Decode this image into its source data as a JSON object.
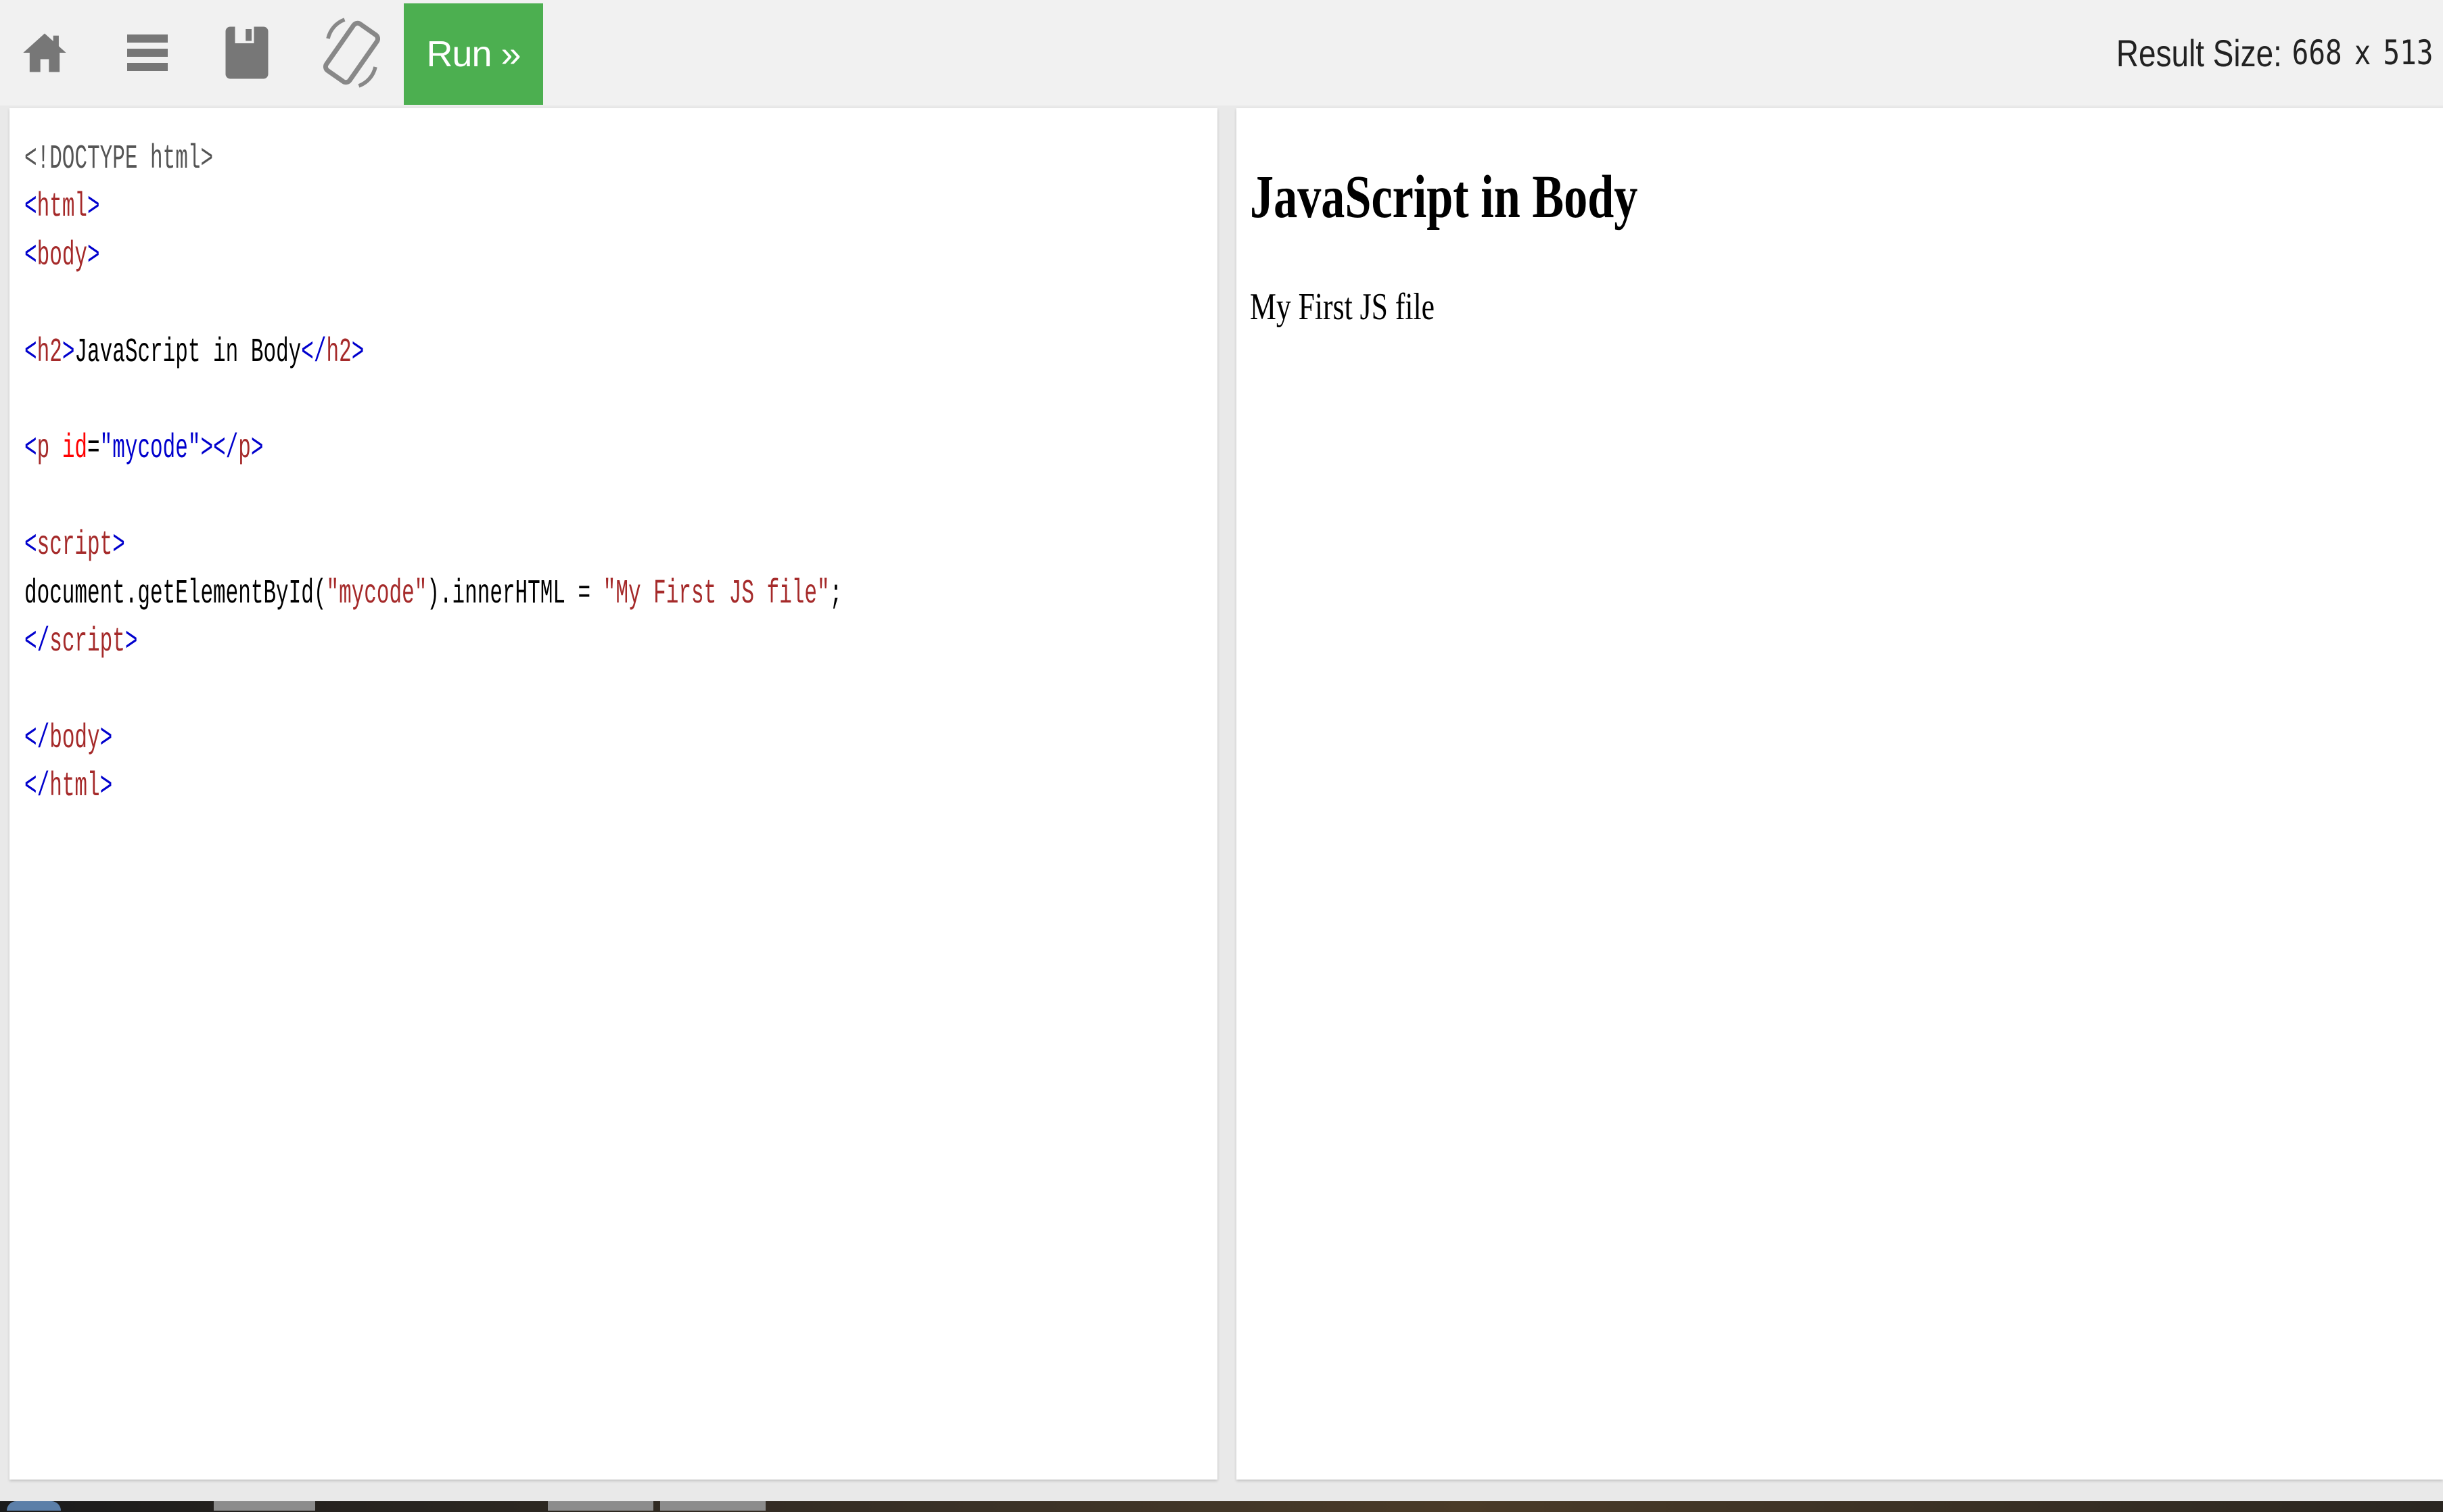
{
  "toolbar": {
    "icons": [
      "home-icon",
      "menu-icon",
      "save-icon",
      "rotate-icon"
    ],
    "run_label": "Run »",
    "result_size_label": "Result Size:",
    "result_width": "668",
    "result_x": "x",
    "result_height": "513"
  },
  "editor": {
    "lines": [
      [
        {
          "t": "doc",
          "s": "<!DOCTYPE html>"
        }
      ],
      [
        {
          "t": "br",
          "s": "<"
        },
        {
          "t": "tag",
          "s": "html"
        },
        {
          "t": "br",
          "s": ">"
        }
      ],
      [
        {
          "t": "br",
          "s": "<"
        },
        {
          "t": "tag",
          "s": "body"
        },
        {
          "t": "br",
          "s": ">"
        }
      ],
      [],
      [
        {
          "t": "br",
          "s": "<"
        },
        {
          "t": "tag",
          "s": "h2"
        },
        {
          "t": "br",
          "s": ">"
        },
        {
          "t": "txt",
          "s": "JavaScript in Body"
        },
        {
          "t": "br",
          "s": "</"
        },
        {
          "t": "tag",
          "s": "h2"
        },
        {
          "t": "br",
          "s": ">"
        }
      ],
      [],
      [
        {
          "t": "br",
          "s": "<"
        },
        {
          "t": "tag",
          "s": "p "
        },
        {
          "t": "attr",
          "s": "id"
        },
        {
          "t": "txt",
          "s": "="
        },
        {
          "t": "val",
          "s": "\"mycode\""
        },
        {
          "t": "br",
          "s": "></"
        },
        {
          "t": "tag",
          "s": "p"
        },
        {
          "t": "br",
          "s": ">"
        }
      ],
      [],
      [
        {
          "t": "br",
          "s": "<"
        },
        {
          "t": "tag",
          "s": "script"
        },
        {
          "t": "br",
          "s": ">"
        }
      ],
      [
        {
          "t": "txt",
          "s": "document.getElementById("
        },
        {
          "t": "str",
          "s": "\"mycode\""
        },
        {
          "t": "txt",
          "s": ").innerHTML = "
        },
        {
          "t": "str",
          "s": "\"My First JS file\""
        },
        {
          "t": "txt",
          "s": ";"
        }
      ],
      [
        {
          "t": "br",
          "s": "</"
        },
        {
          "t": "tag",
          "s": "script"
        },
        {
          "t": "br",
          "s": ">"
        }
      ],
      [],
      [
        {
          "t": "br",
          "s": "</"
        },
        {
          "t": "tag",
          "s": "body"
        },
        {
          "t": "br",
          "s": ">"
        }
      ],
      [
        {
          "t": "br",
          "s": "</"
        },
        {
          "t": "tag",
          "s": "html"
        },
        {
          "t": "br",
          "s": ">"
        }
      ]
    ]
  },
  "result": {
    "heading": "JavaScript in Body",
    "paragraph": "My First JS file"
  },
  "colors": {
    "run_button": "#4caf50",
    "toolbar_bg": "#f1f1f1",
    "icon_gray": "#777777"
  }
}
